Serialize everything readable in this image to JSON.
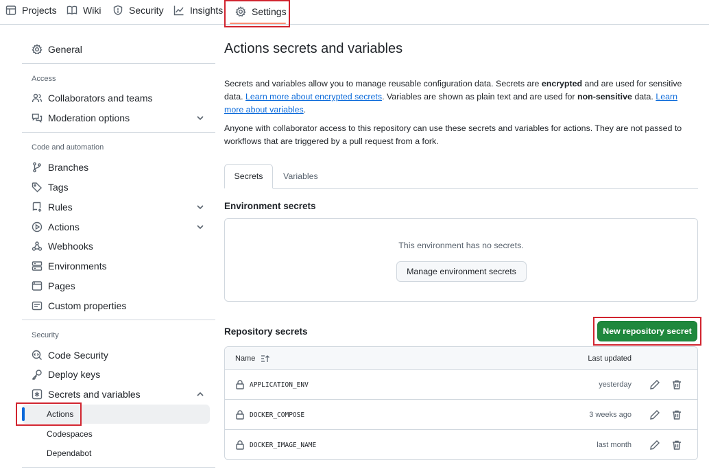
{
  "topnav": {
    "tabs": [
      {
        "label": "Projects",
        "icon": "table-icon"
      },
      {
        "label": "Wiki",
        "icon": "book-icon"
      },
      {
        "label": "Security",
        "icon": "shield-icon"
      },
      {
        "label": "Insights",
        "icon": "graph-icon"
      },
      {
        "label": "Settings",
        "icon": "gear-icon",
        "selected": true
      }
    ]
  },
  "sidebar": {
    "general": "General",
    "access_heading": "Access",
    "collaborators": "Collaborators and teams",
    "moderation": "Moderation options",
    "code_heading": "Code and automation",
    "branches": "Branches",
    "tags": "Tags",
    "rules": "Rules",
    "actions": "Actions",
    "webhooks": "Webhooks",
    "environments": "Environments",
    "pages": "Pages",
    "custom_properties": "Custom properties",
    "security_heading": "Security",
    "code_security": "Code Security",
    "deploy_keys": "Deploy keys",
    "secrets_variables": "Secrets and variables",
    "sub_actions": "Actions",
    "sub_codespaces": "Codespaces",
    "sub_dependabot": "Dependabot"
  },
  "main": {
    "title": "Actions secrets and variables",
    "intro": {
      "t1": "Secrets and variables allow you to manage reusable configuration data. Secrets are ",
      "b1": "encrypted",
      "t2": " and are used for sensitive data. ",
      "link1": "Learn more about encrypted secrets",
      "t3": ". Variables are shown as plain text and are used for ",
      "b2": "non-sensitive",
      "t4": " data. ",
      "link2": "Learn more about variables",
      "t5": "."
    },
    "note": "Anyone with collaborator access to this repository can use these secrets and variables for actions. They are not passed to workflows that are triggered by a pull request from a fork.",
    "tabs": {
      "secrets": "Secrets",
      "variables": "Variables"
    },
    "env_heading": "Environment secrets",
    "env_empty": "This environment has no secrets.",
    "env_button": "Manage environment secrets",
    "repo_heading": "Repository secrets",
    "new_button": "New repository secret",
    "table": {
      "col_name": "Name",
      "col_updated": "Last updated",
      "rows": [
        {
          "name": "APPLICATION_ENV",
          "updated": "yesterday"
        },
        {
          "name": "DOCKER_COMPOSE",
          "updated": "3 weeks ago"
        },
        {
          "name": "DOCKER_IMAGE_NAME",
          "updated": "last month"
        }
      ]
    }
  },
  "colors": {
    "accent": "#0969da",
    "primary_button": "#1f883d",
    "highlight_box": "#d1242f",
    "selected_tab_underline": "#fd8c73"
  }
}
